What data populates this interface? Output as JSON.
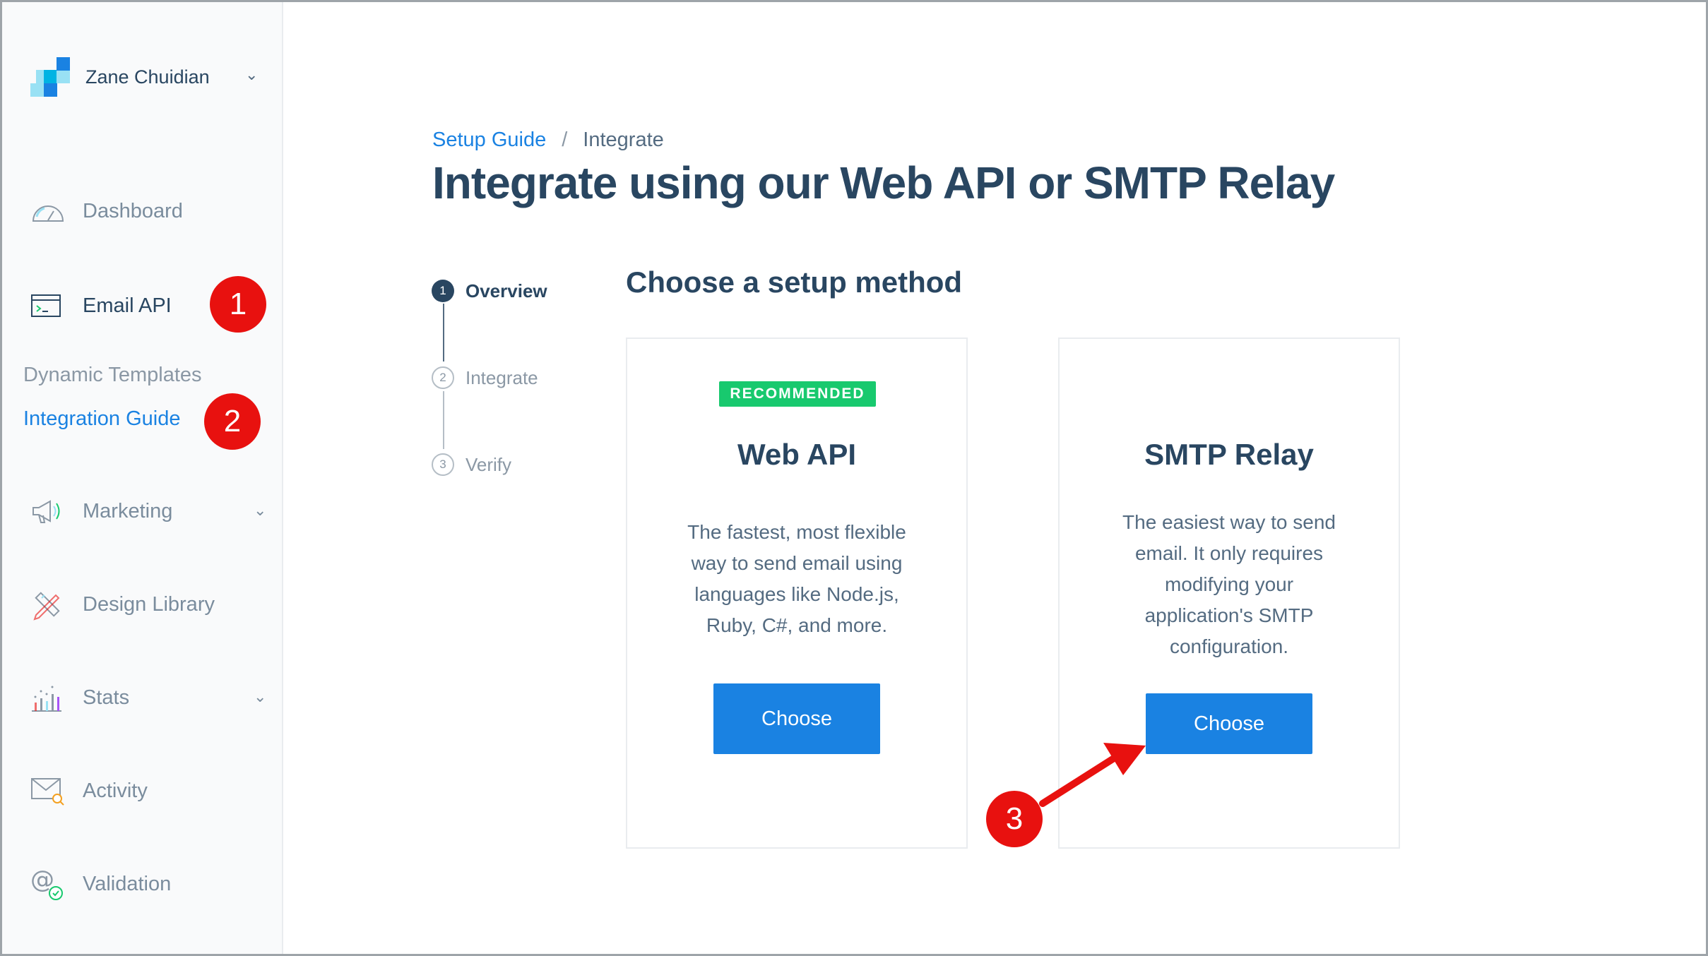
{
  "sidebar": {
    "account_name": "Zane Chuidian",
    "nav": {
      "dashboard": "Dashboard",
      "email_api": "Email API",
      "marketing": "Marketing",
      "design_library": "Design Library",
      "stats": "Stats",
      "activity": "Activity",
      "validation": "Validation"
    },
    "subnav": {
      "dynamic_templates": "Dynamic Templates",
      "integration_guide": "Integration Guide"
    }
  },
  "annotations": {
    "one": "1",
    "two": "2",
    "three": "3"
  },
  "breadcrumb": {
    "parent": "Setup Guide",
    "separator": "/",
    "current": "Integrate"
  },
  "page_title": "Integrate using our Web API or SMTP Relay",
  "stepper": [
    {
      "number": "1",
      "label": "Overview",
      "state": "current"
    },
    {
      "number": "2",
      "label": "Integrate",
      "state": "todo"
    },
    {
      "number": "3",
      "label": "Verify",
      "state": "todo"
    }
  ],
  "section_title": "Choose a setup method",
  "cards": {
    "web_api": {
      "badge": "RECOMMENDED",
      "title": "Web API",
      "description": "The fastest, most flexible way to send email using languages like Node.js, Ruby, C#, and more.",
      "button": "Choose"
    },
    "smtp": {
      "title": "SMTP Relay",
      "description": "The easiest way to send email. It only requires modifying your application's SMTP configuration.",
      "button": "Choose"
    }
  },
  "colors": {
    "accent_blue": "#1a82e2",
    "title_navy": "#294661",
    "recommended_green": "#18c96e",
    "annotation_red": "#e8110f"
  },
  "icons": {
    "logo": "sendgrid-logo",
    "dashboard": "speedometer-icon",
    "email_api": "terminal-window-icon",
    "marketing": "megaphone-icon",
    "design_library": "pencil-ruler-icon",
    "stats": "bar-chart-icon",
    "activity": "envelope-search-icon",
    "validation": "at-check-icon"
  }
}
